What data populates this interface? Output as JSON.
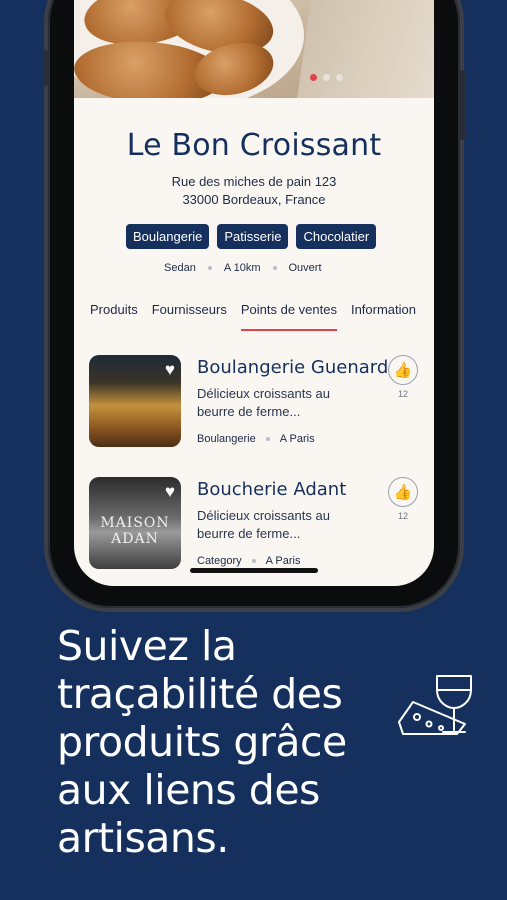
{
  "shop": {
    "name": "Le Bon Croissant",
    "address_line1": "Rue des miches de pain 123",
    "address_line2": "33000 Bordeaux, France",
    "tags": [
      "Boulangerie",
      "Patisserie",
      "Chocolatier"
    ],
    "meta": [
      "Sedan",
      "A 10km",
      "Ouvert"
    ]
  },
  "carousel": {
    "dots": 3,
    "active_index": 0
  },
  "tabs": [
    {
      "label": "Produits",
      "active": false
    },
    {
      "label": "Fournisseurs",
      "active": false
    },
    {
      "label": "Points de ventes",
      "active": true
    },
    {
      "label": "Information",
      "active": false
    }
  ],
  "cards": [
    {
      "name": "Boulangerie Guenard",
      "desc_line1": "Délicieux croissants au",
      "desc_line2": "beurre de ferme...",
      "category": "Boulangerie",
      "location": "A Paris",
      "likes": "12",
      "thumb_icon": "heart-icon"
    },
    {
      "name": "Boucherie Adant",
      "desc_line1": "Délicieux croissants au",
      "desc_line2": "beurre de ferme...",
      "category": "Category",
      "location": "A Paris",
      "likes": "12",
      "thumb_icon": "heart-icon",
      "thumb_sign": "MAISON ADAN"
    }
  ],
  "headline": {
    "line1": "Suivez la",
    "line2": "traçabilité des",
    "line3": "produits grâce",
    "line4": "aux liens des",
    "line5": "artisans."
  },
  "colors": {
    "navy": "#16305e",
    "accent_red": "#e0424f",
    "screen_bg": "#faf7f3"
  }
}
